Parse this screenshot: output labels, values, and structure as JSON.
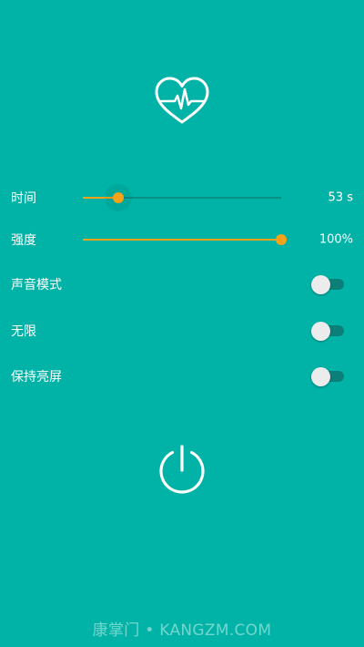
{
  "icons": {
    "heart": "heart-pulse-icon",
    "power": "power-icon"
  },
  "colors": {
    "background": "#00b3a6",
    "accent": "#f7a21b",
    "track": "#0a8f86",
    "switch_track": "#0b7f78",
    "switch_thumb": "#ececec"
  },
  "controls": {
    "time": {
      "label": "时间",
      "value": "53 s",
      "level": 0.18
    },
    "intensity": {
      "label": "强度",
      "value": "100%",
      "level": 1.0
    },
    "sound_mode": {
      "label": "声音模式",
      "on": false
    },
    "unlimited": {
      "label": "无限",
      "on": false
    },
    "keep_screen_on": {
      "label": "保持亮屏",
      "on": false
    }
  },
  "watermark": "康掌门 • KANGZM.COM"
}
